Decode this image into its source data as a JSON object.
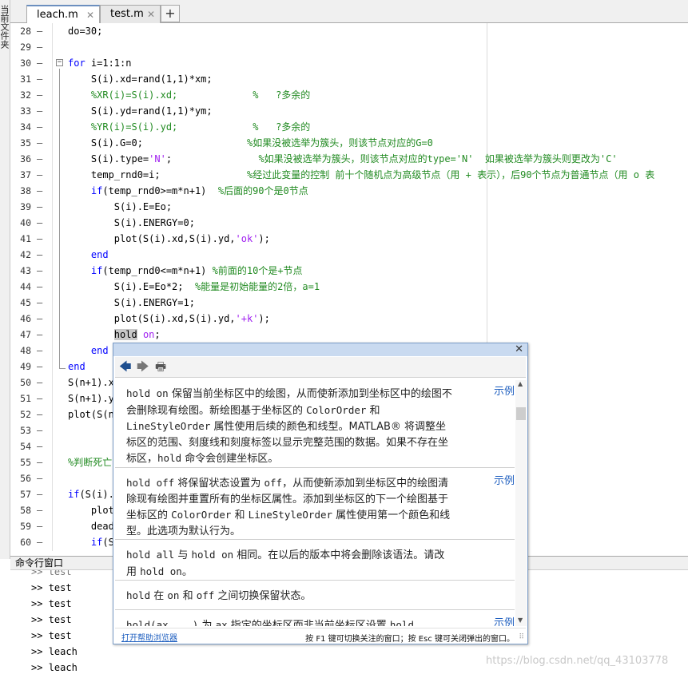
{
  "left_panel_label": "当前文件夹",
  "tabs": [
    {
      "label": "leach.m",
      "active": true
    },
    {
      "label": "test.m",
      "active": false
    }
  ],
  "add_tab_label": "+",
  "close_symbol": "✕",
  "fold_symbol": "−",
  "editor_lines": [
    {
      "n": "28",
      "segs": [
        {
          "t": "do=30;",
          "c": ""
        }
      ]
    },
    {
      "n": "29",
      "segs": []
    },
    {
      "n": "30",
      "segs": [
        {
          "t": "for",
          "c": "kw"
        },
        {
          "t": " i=1:1:n",
          "c": ""
        }
      ]
    },
    {
      "n": "31",
      "segs": [
        {
          "t": "    S(i).xd=rand(1,1)*xm;",
          "c": ""
        }
      ]
    },
    {
      "n": "32",
      "segs": [
        {
          "t": "    %XR(i)=S(i).xd;             %   ?多余的",
          "c": "cm"
        }
      ]
    },
    {
      "n": "33",
      "segs": [
        {
          "t": "    S(i).yd=rand(1,1)*ym;",
          "c": ""
        }
      ]
    },
    {
      "n": "34",
      "segs": [
        {
          "t": "    %YR(i)=S(i).yd;             %   ?多余的",
          "c": "cm"
        }
      ]
    },
    {
      "n": "35",
      "segs": [
        {
          "t": "    S(i).G=0;                  ",
          "c": ""
        },
        {
          "t": "%如果没被选举为簇头，则该节点对应的G=0",
          "c": "cm"
        }
      ]
    },
    {
      "n": "36",
      "segs": [
        {
          "t": "    S(i).type=",
          "c": ""
        },
        {
          "t": "'N'",
          "c": "str"
        },
        {
          "t": ";               ",
          "c": ""
        },
        {
          "t": "%如果没被选举为簇头，则该节点对应的type='N'  如果被选举为簇头则更改为'C'",
          "c": "cm"
        }
      ]
    },
    {
      "n": "37",
      "segs": [
        {
          "t": "    temp_rnd0=i;               ",
          "c": ""
        },
        {
          "t": "%经过此变量的控制 前十个随机点为高级节点（用 + 表示），后90个节点为普通节点（用 o 表",
          "c": "cm"
        }
      ]
    },
    {
      "n": "38",
      "segs": [
        {
          "t": "    ",
          "c": ""
        },
        {
          "t": "if",
          "c": "kw"
        },
        {
          "t": "(temp_rnd0>=m*n+1)  ",
          "c": ""
        },
        {
          "t": "%后面的90个是0节点",
          "c": "cm"
        }
      ]
    },
    {
      "n": "39",
      "segs": [
        {
          "t": "        S(i).E=Eo;",
          "c": ""
        }
      ]
    },
    {
      "n": "40",
      "segs": [
        {
          "t": "        S(i).ENERGY=0;",
          "c": ""
        }
      ]
    },
    {
      "n": "41",
      "segs": [
        {
          "t": "        plot(S(i).xd,S(i).yd,",
          "c": ""
        },
        {
          "t": "'ok'",
          "c": "str"
        },
        {
          "t": ");",
          "c": ""
        }
      ]
    },
    {
      "n": "42",
      "segs": [
        {
          "t": "    ",
          "c": ""
        },
        {
          "t": "end",
          "c": "kw"
        }
      ]
    },
    {
      "n": "43",
      "segs": [
        {
          "t": "    ",
          "c": ""
        },
        {
          "t": "if",
          "c": "kw"
        },
        {
          "t": "(temp_rnd0<=m*n+1) ",
          "c": ""
        },
        {
          "t": "%前面的10个是+节点",
          "c": "cm"
        }
      ]
    },
    {
      "n": "44",
      "segs": [
        {
          "t": "        S(i).E=Eo*2;  ",
          "c": ""
        },
        {
          "t": "%能量是初始能量的2倍，a=1",
          "c": "cm"
        }
      ]
    },
    {
      "n": "45",
      "segs": [
        {
          "t": "        S(i).ENERGY=1;",
          "c": ""
        }
      ]
    },
    {
      "n": "46",
      "segs": [
        {
          "t": "        plot(S(i).xd,S(i).yd,",
          "c": ""
        },
        {
          "t": "'+k'",
          "c": "str"
        },
        {
          "t": ");",
          "c": ""
        }
      ]
    },
    {
      "n": "47",
      "segs": [
        {
          "t": "        ",
          "c": ""
        },
        {
          "t": "hold",
          "c": "hl"
        },
        {
          "t": " ",
          "c": ""
        },
        {
          "t": "on",
          "c": "str"
        },
        {
          "t": ";",
          "c": ""
        }
      ]
    },
    {
      "n": "48",
      "segs": [
        {
          "t": "    ",
          "c": ""
        },
        {
          "t": "end",
          "c": "kw"
        }
      ]
    },
    {
      "n": "49",
      "segs": [
        {
          "t": "end",
          "c": "kw"
        }
      ]
    },
    {
      "n": "50",
      "segs": [
        {
          "t": "S(n+1).x",
          "c": ""
        }
      ]
    },
    {
      "n": "51",
      "segs": [
        {
          "t": "S(n+1).y",
          "c": ""
        }
      ]
    },
    {
      "n": "52",
      "segs": [
        {
          "t": "plot(S(n",
          "c": ""
        }
      ]
    },
    {
      "n": "53",
      "segs": []
    },
    {
      "n": "54",
      "segs": []
    },
    {
      "n": "55",
      "segs": [
        {
          "t": "%判断死亡",
          "c": "cm"
        }
      ]
    },
    {
      "n": "56",
      "segs": []
    },
    {
      "n": "57",
      "segs": [
        {
          "t": "if",
          "c": "kw"
        },
        {
          "t": "(S(i).",
          "c": ""
        }
      ]
    },
    {
      "n": "58",
      "segs": [
        {
          "t": "    plot",
          "c": ""
        }
      ]
    },
    {
      "n": "59",
      "segs": [
        {
          "t": "    dead",
          "c": ""
        }
      ]
    },
    {
      "n": "60",
      "segs": [
        {
          "t": "    ",
          "c": ""
        },
        {
          "t": "if",
          "c": "kw"
        },
        {
          "t": "(S",
          "c": ""
        }
      ]
    }
  ],
  "command_window": {
    "title": "命令行窗口",
    "prompt": ">>",
    "lines": [
      "test",
      "test",
      "test",
      "test",
      "test",
      "leach",
      "leach"
    ]
  },
  "help_popup": {
    "nav_back_icon": "🡄",
    "nav_forward_icon": "🡆",
    "print_icon": "🖶",
    "example_label": "示例",
    "open_help_browser": "打开帮助浏览器",
    "footer_hint": "按 F1 键可切换关注的窗口；按 Esc 键可关闭弹出的窗口。",
    "entries": [
      {
        "segs": [
          {
            "t": "hold on",
            "m": true
          },
          {
            "t": " 保留当前坐标区中的绘图，从而使新添加到坐标区中的绘图不会删除现有绘图。新绘图基于坐标区的 ",
            "m": false
          },
          {
            "t": "ColorOrder",
            "m": true
          },
          {
            "t": " 和 ",
            "m": false
          },
          {
            "t": "LineStyleOrder",
            "m": true
          },
          {
            "t": " 属性使用后续的颜色和线型。MATLAB® 将调整坐标区的范围、刻度线和刻度标签以显示完整范围的数据。如果不存在坐标区，",
            "m": false
          },
          {
            "t": "hold",
            "m": true
          },
          {
            "t": " 命令会创建坐标区。",
            "m": false
          }
        ],
        "example": true
      },
      {
        "segs": [
          {
            "t": "hold off",
            "m": true
          },
          {
            "t": " 将保留状态设置为 ",
            "m": false
          },
          {
            "t": "off",
            "m": true
          },
          {
            "t": "，从而使新添加到坐标区中的绘图清除现有绘图并重置所有的坐标区属性。添加到坐标区的下一个绘图基于坐标区的 ",
            "m": false
          },
          {
            "t": "ColorOrder",
            "m": true
          },
          {
            "t": " 和 ",
            "m": false
          },
          {
            "t": "LineStyleOrder",
            "m": true
          },
          {
            "t": " 属性使用第一个颜色和线型。此选项为默认行为。",
            "m": false
          }
        ],
        "example": true
      },
      {
        "segs": [
          {
            "t": "hold all",
            "m": true
          },
          {
            "t": " 与 ",
            "m": false
          },
          {
            "t": "hold on",
            "m": true
          },
          {
            "t": " 相同。在以后的版本中将会删除该语法。请改用 ",
            "m": false
          },
          {
            "t": "hold on",
            "m": true
          },
          {
            "t": "。",
            "m": false
          }
        ],
        "example": false
      },
      {
        "segs": [
          {
            "t": "hold",
            "m": true
          },
          {
            "t": " 在 ",
            "m": false
          },
          {
            "t": "on",
            "m": true
          },
          {
            "t": " 和 ",
            "m": false
          },
          {
            "t": "off",
            "m": true
          },
          {
            "t": " 之间切换保留状态。",
            "m": false
          }
        ],
        "example": false
      },
      {
        "segs": [
          {
            "t": "hold(ax,___)",
            "m": true
          },
          {
            "t": " 为 ",
            "m": false
          },
          {
            "t": "ax",
            "m": true
          },
          {
            "t": " 指定的坐标区而非当前坐标区设置 ",
            "m": false
          },
          {
            "t": "hold",
            "m": true
          }
        ],
        "example": true
      }
    ]
  },
  "watermark": "https://blog.csdn.net/qq_43103778",
  "colors": {
    "keyword": "#0000ff",
    "comment": "#228b22",
    "string": "#a020f0",
    "link": "#2060c0"
  }
}
